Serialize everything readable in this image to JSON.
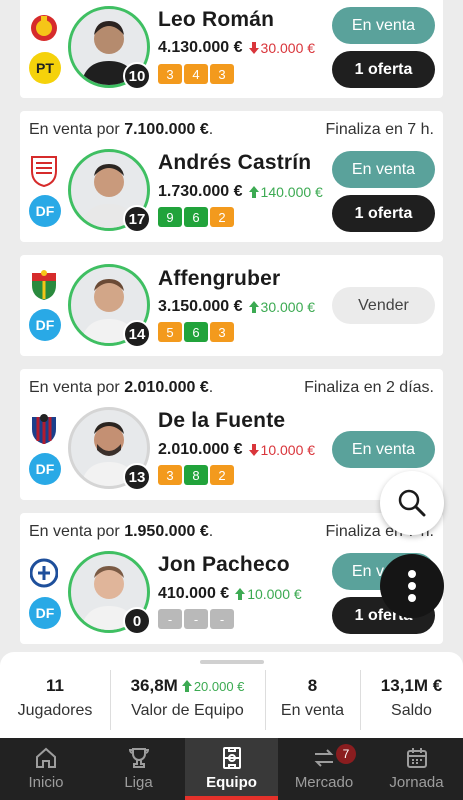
{
  "players": [
    {
      "sale": null,
      "position": "PT",
      "name": "Leo Román",
      "value": "4.130.000 €",
      "change": "30.000 €",
      "change_dir": "down",
      "number": "10",
      "points": [
        "3",
        "4",
        "3"
      ],
      "actions": [
        "En venta",
        "1 oferta"
      ]
    },
    {
      "sale": {
        "prefix": "En venta por",
        "amount": "7.100.000 €",
        "suffix": ".",
        "ends": "Finaliza en 7 h."
      },
      "position": "DF",
      "name": "Andrés Castrín",
      "value": "1.730.000 €",
      "change": "140.000 €",
      "change_dir": "up",
      "number": "17",
      "points": [
        "9",
        "6",
        "2"
      ],
      "actions": [
        "En venta",
        "1 oferta"
      ]
    },
    {
      "sale": null,
      "position": "DF",
      "name": "Affengruber",
      "value": "3.150.000 €",
      "change": "30.000 €",
      "change_dir": "up",
      "number": "14",
      "points": [
        "5",
        "6",
        "3"
      ],
      "actions": [
        "Vender"
      ]
    },
    {
      "sale": {
        "prefix": "En venta por",
        "amount": "2.010.000 €",
        "suffix": ".",
        "ends": "Finaliza en 2 días."
      },
      "position": "DF",
      "name": "De la Fuente",
      "value": "2.010.000 €",
      "change": "10.000 €",
      "change_dir": "down",
      "number": "13",
      "points": [
        "3",
        "8",
        "2"
      ],
      "actions": [
        "En venta"
      ]
    },
    {
      "sale": {
        "prefix": "En venta por",
        "amount": "1.950.000 €",
        "suffix": ".",
        "ends": "Finaliza en 7 h."
      },
      "position": "DF",
      "name": "Jon Pacheco",
      "value": "410.000 €",
      "change": "10.000 €",
      "change_dir": "up",
      "number": "0",
      "points": [
        "-",
        "-",
        "-"
      ],
      "actions": [
        "En venta",
        "1 oferta"
      ]
    }
  ],
  "stats": [
    {
      "value": "11",
      "label": "Jugadores"
    },
    {
      "value": "36,8M",
      "sub": "20.000 €",
      "label": "Valor de Equipo"
    },
    {
      "value": "8",
      "label": "En venta"
    },
    {
      "value": "13,1M €",
      "label": "Saldo"
    }
  ],
  "nav": {
    "items": [
      "Inicio",
      "Liga",
      "Equipo",
      "Mercado",
      "Jornada"
    ],
    "active": "Equipo",
    "mercado_badge": "7"
  },
  "icons": [
    "search-icon",
    "more-vertical-icon",
    "home-icon",
    "trophy-icon",
    "team-icon",
    "transfer-icon",
    "calendar-icon"
  ],
  "colors": {
    "accent": "#e5312a",
    "teal": "#5aa29b",
    "up": "#3caa52",
    "down": "#d9353b",
    "points_orange": "#f39a1d",
    "points_green": "#21a33b"
  }
}
